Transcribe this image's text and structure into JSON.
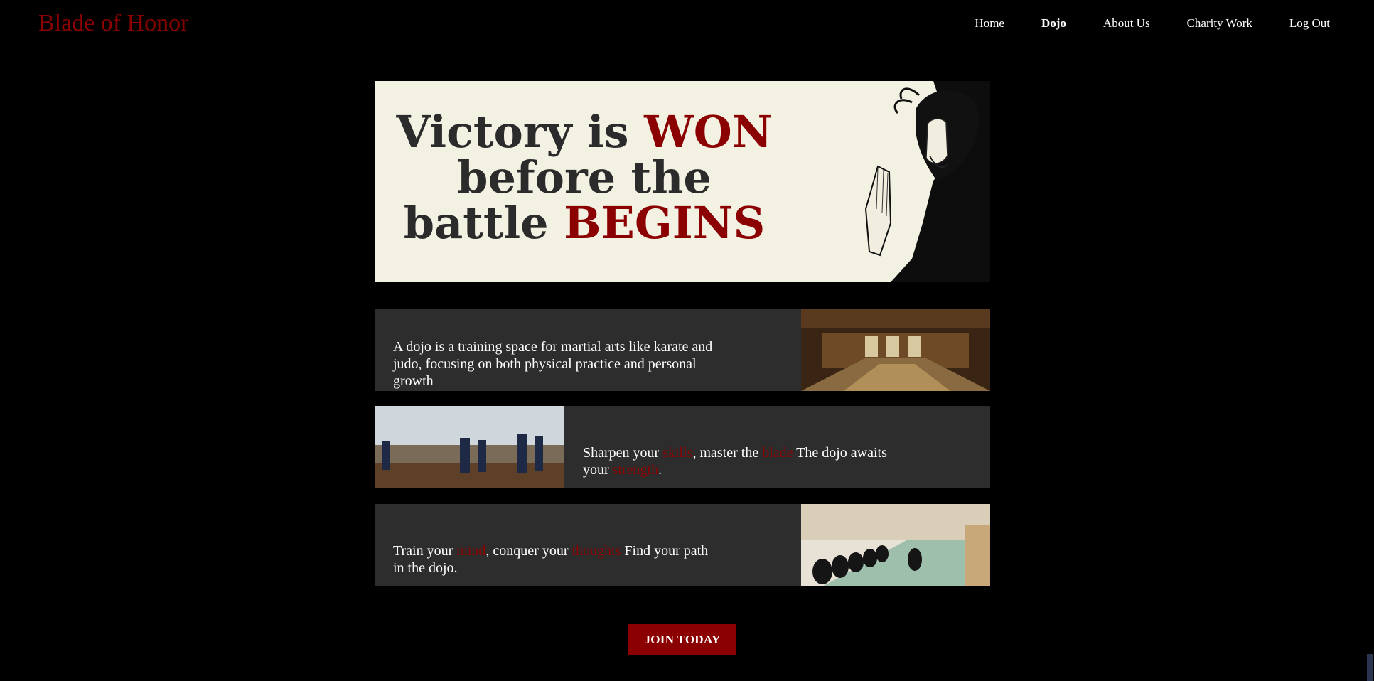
{
  "brand": "Blade of Honor",
  "nav": {
    "home": "Home",
    "dojo": "Dojo",
    "about": "About Us",
    "charity": "Charity Work",
    "logout": "Log Out"
  },
  "hero": {
    "l1a": "Victory is ",
    "l1b": "WON",
    "l2": "before the",
    "l3a": "battle ",
    "l3b": "BEGINS"
  },
  "card1": {
    "text": "A dojo is a training space for martial arts like karate and judo, focusing on both physical practice and personal growth"
  },
  "card2": {
    "t1": "Sharpen your ",
    "r1": "skills",
    "t2": ", master the ",
    "r2": "blade",
    "t3": " The dojo awaits your ",
    "r3": "strength",
    "t4": "."
  },
  "card3": {
    "t1": "Train your ",
    "r1": "mind",
    "t2": ", conquer your ",
    "r2": "thoughts",
    "t3": " Find your path in the dojo."
  },
  "cta": "JOIN TODAY",
  "colors": {
    "accent": "#8b0000",
    "panel": "#2d2d2d",
    "hero_bg": "#f3f1e2"
  }
}
